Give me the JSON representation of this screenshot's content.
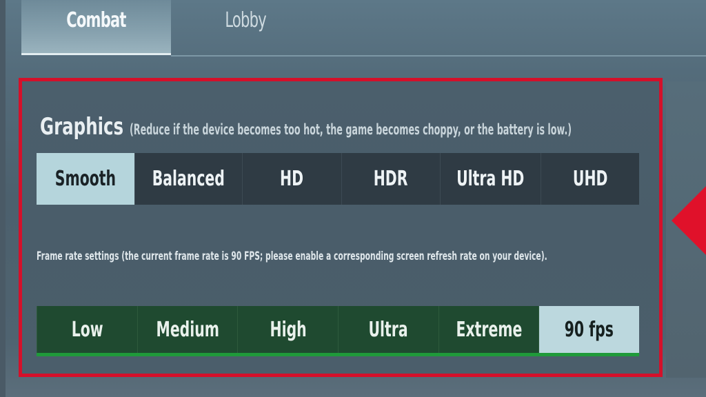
{
  "tabs": [
    {
      "label": "Combat",
      "active": true
    },
    {
      "label": "Lobby",
      "active": false
    }
  ],
  "graphics": {
    "title": "Graphics",
    "note": "(Reduce if the device becomes too hot, the game becomes choppy, or the battery is low.)",
    "options": [
      "Smooth",
      "Balanced",
      "HD",
      "HDR",
      "Ultra HD",
      "UHD"
    ],
    "selected": "Smooth"
  },
  "frame_rate": {
    "note": "Frame rate settings (the current frame rate is 90 FPS; please enable a corresponding screen refresh rate on your device).",
    "options": [
      "Low",
      "Medium",
      "High",
      "Ultra",
      "Extreme",
      "90 fps"
    ],
    "selected": "90 fps"
  },
  "colors": {
    "highlight_border": "#d4102a",
    "selected_option": "#b5d5dc",
    "fps_bar": "#1f4a30",
    "fps_underline": "#1f9a3a"
  }
}
